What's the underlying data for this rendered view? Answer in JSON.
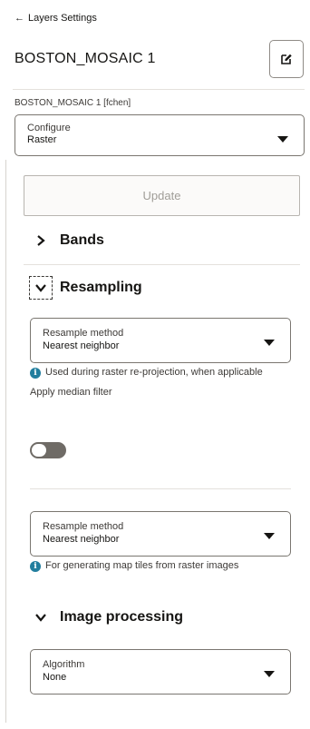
{
  "header": {
    "back_label": "Layers Settings",
    "layer_name": "BOSTON_MOSAIC 1",
    "edit_icon": "edit-icon",
    "layer_subtitle": "BOSTON_MOSAIC 1 [fchen]"
  },
  "configure": {
    "label": "Configure",
    "value": "Raster"
  },
  "update_label": "Update",
  "sections": {
    "bands": "Bands",
    "resampling": "Resampling",
    "image_processing": "Image processing"
  },
  "resampling": {
    "method1": {
      "label": "Resample method",
      "value": "Nearest neighbor"
    },
    "info1": "Used during raster re-projection, when applicable",
    "median_filter_label": "Apply median filter",
    "median_filter_on": false,
    "method2": {
      "label": "Resample method",
      "value": "Nearest neighbor"
    },
    "info2": "For generating map tiles from raster images"
  },
  "image_processing": {
    "algorithm": {
      "label": "Algorithm",
      "value": "None"
    }
  },
  "colors": {
    "info": "#227e9e",
    "text": "#161513",
    "border": "#7a7670"
  }
}
